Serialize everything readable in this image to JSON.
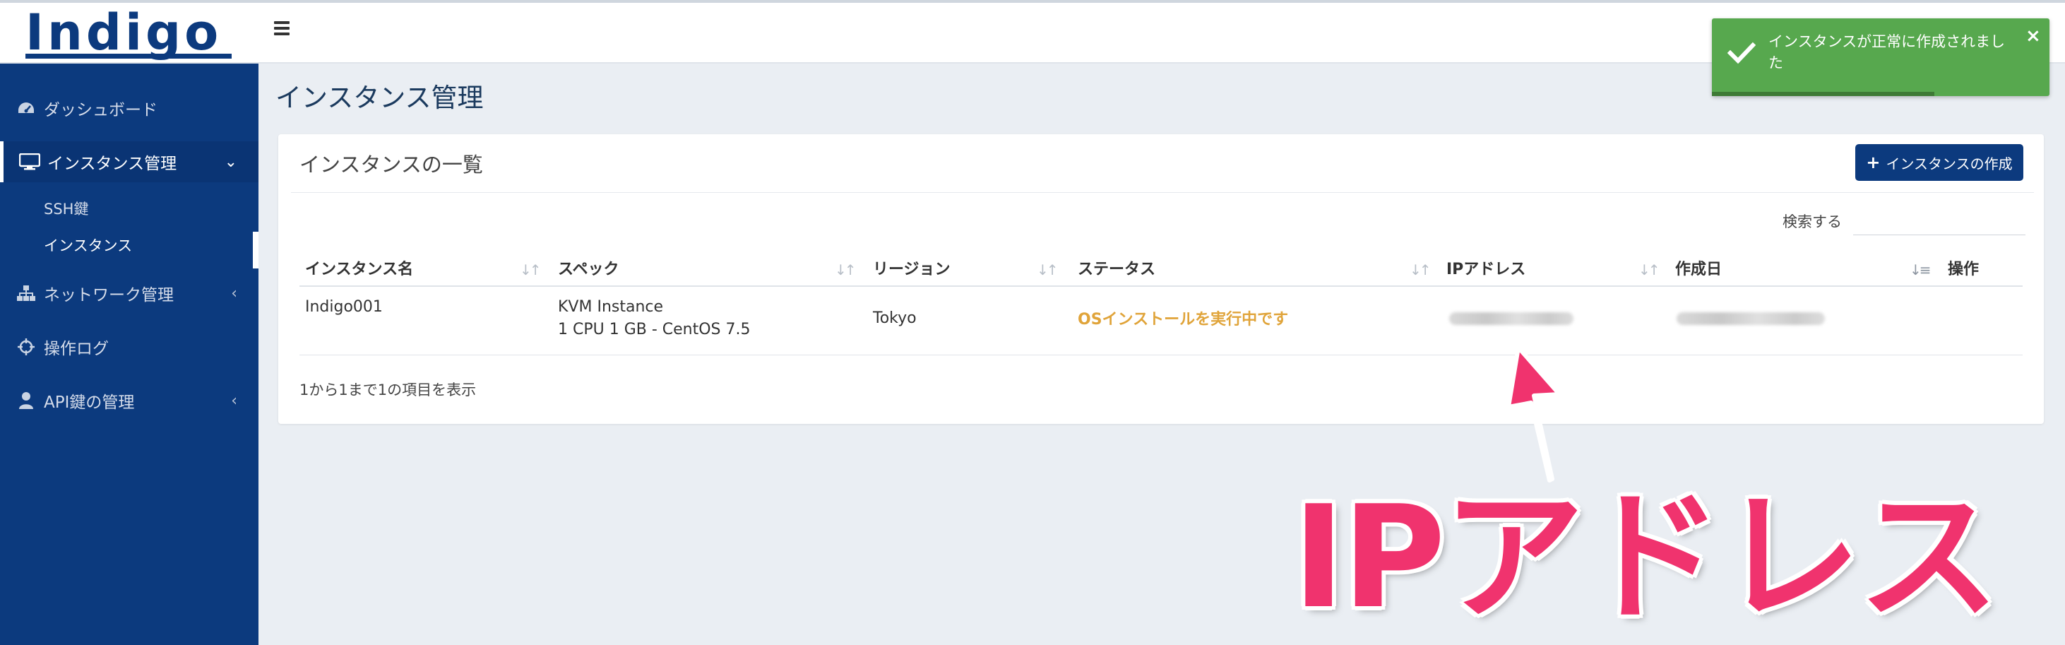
{
  "app": {
    "logo": "Indigo"
  },
  "colors": {
    "primary": "#0c3a7e",
    "toast_bg": "#57a84e",
    "status_text": "#e0a43a",
    "annotation": "#f0336e"
  },
  "sidebar": {
    "items": [
      {
        "label": "ダッシュボード",
        "icon": "dashboard-icon"
      },
      {
        "label": "インスタンス管理",
        "icon": "monitor-icon",
        "expanded": true,
        "sub": [
          {
            "label": "SSH鍵"
          },
          {
            "label": "インスタンス"
          }
        ]
      },
      {
        "label": "ネットワーク管理",
        "icon": "network-icon"
      },
      {
        "label": "操作ログ",
        "icon": "crosshair-icon"
      },
      {
        "label": "API鍵の管理",
        "icon": "user-icon"
      }
    ],
    "chevron_down": "⌄",
    "chevron_left": "‹"
  },
  "page": {
    "title": "インスタンス管理"
  },
  "card": {
    "title": "インスタンスの一覧",
    "create_button": "インスタンスの作成",
    "search_label": "検索する",
    "search_value": "",
    "columns": [
      "インスタンス名",
      "スペック",
      "リージョン",
      "ステータス",
      "IPアドレス",
      "作成日",
      "操作"
    ],
    "rows": [
      {
        "name": "Indigo001",
        "spec_line1": "KVM Instance",
        "spec_line2": "1 CPU 1 GB - CentOS 7.5",
        "region": "Tokyo",
        "status": "OSインストールを実行中です"
      }
    ],
    "info": "1から1まで1の項目を表示"
  },
  "toast": {
    "message": "インスタンスが正常に作成されました",
    "close": "×",
    "progress_fraction": 0.66
  },
  "annotation": {
    "text": "IPアドレス"
  }
}
